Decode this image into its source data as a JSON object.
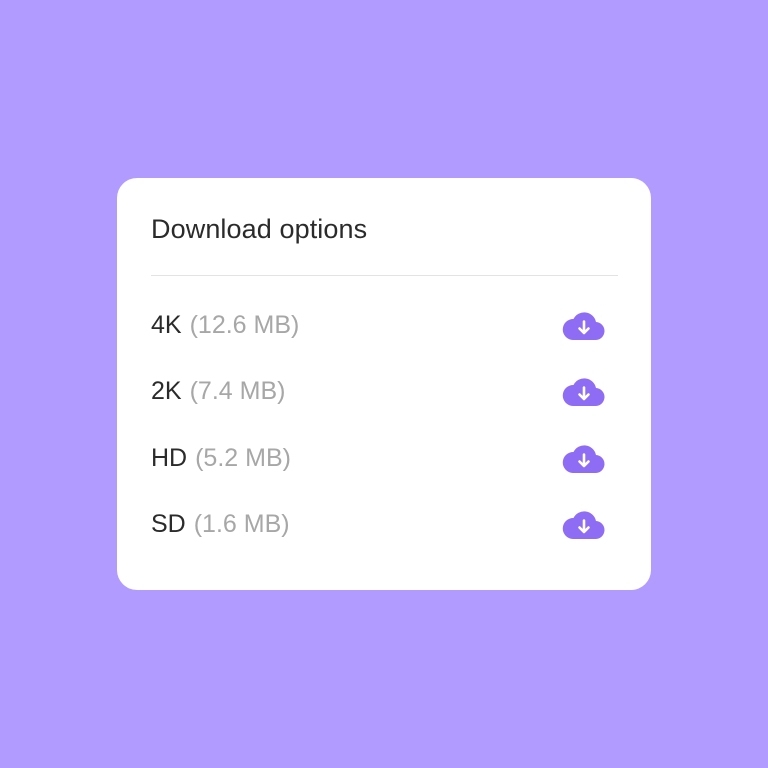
{
  "panel": {
    "title": "Download options"
  },
  "options": [
    {
      "resolution": "4K",
      "size": "(12.6 MB)",
      "icon": "cloud-download-icon"
    },
    {
      "resolution": "2K",
      "size": "(7.4 MB)",
      "icon": "cloud-download-icon"
    },
    {
      "resolution": "HD",
      "size": "(5.2 MB)",
      "icon": "cloud-download-icon"
    },
    {
      "resolution": "SD",
      "size": "(1.6 MB)",
      "icon": "cloud-download-icon"
    }
  ],
  "colors": {
    "background": "#b29bff",
    "accent": "#8e6cf4",
    "text": "#2b2b2b",
    "muted": "#a7a7a7"
  }
}
